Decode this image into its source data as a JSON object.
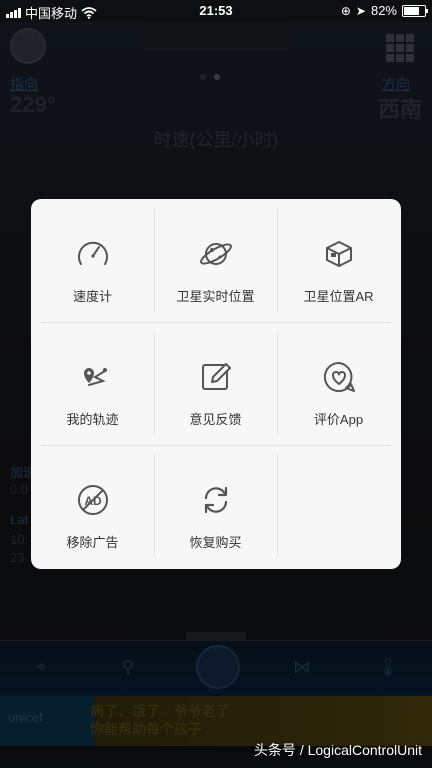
{
  "status_bar": {
    "carrier": "中国移动",
    "time": "21:53",
    "battery": "82%",
    "battery_level": 0.82
  },
  "background": {
    "heading_label": "指向",
    "heading_value": "229°",
    "direction_label": "方向",
    "direction_value": "西南",
    "speed_title": "时速(公里/小时)",
    "left_label_1": "加速",
    "left_value_1": "0.0",
    "left_label_2": "Lat",
    "left_value_2": "10:",
    "left_value_3": "23",
    "ad_brand": "unicef",
    "ad_line_1": "病了、饿了、爷爷老了",
    "ad_line_2": "你能帮助每个孩子"
  },
  "menu": {
    "items": [
      {
        "label": "速度计",
        "icon": "speedometer-icon"
      },
      {
        "label": "卫星实时位置",
        "icon": "satellite-planet-icon"
      },
      {
        "label": "卫星位置AR",
        "icon": "ar-cube-icon"
      },
      {
        "label": "我的轨迹",
        "icon": "track-route-icon"
      },
      {
        "label": "意见反馈",
        "icon": "feedback-edit-icon"
      },
      {
        "label": "评价App",
        "icon": "rate-heart-icon"
      },
      {
        "label": "移除广告",
        "icon": "remove-ad-icon"
      },
      {
        "label": "恢复购买",
        "icon": "restore-purchase-icon"
      }
    ]
  },
  "watermark": "头条号 / LogicalControlUnit"
}
